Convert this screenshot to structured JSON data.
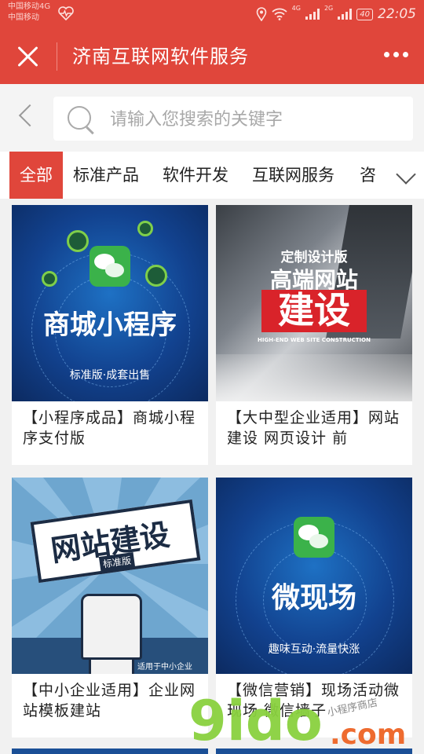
{
  "status_bar": {
    "carrier_line1": "中国移动4G",
    "carrier_line2": "中国移动",
    "net1": "4G",
    "net2": "2G",
    "battery": "40",
    "time": "22:05"
  },
  "title_bar": {
    "title": "济南互联网软件服务"
  },
  "search": {
    "placeholder": "请输入您搜索的关键字"
  },
  "tabs": [
    "全部",
    "标准产品",
    "软件开发",
    "互联网服务",
    "咨"
  ],
  "products": [
    {
      "title": "【小程序成品】商城小程序支付版",
      "art_title": "商城小程序",
      "art_sub": "标准版·成套出售"
    },
    {
      "title": "【大中型企业适用】网站建设 网页设计 前",
      "art_top": "定制设计版",
      "art_mid": "高端网站",
      "art_big": "建设",
      "art_sub": "HIGH-END WEB SITE CONSTRUCTION"
    },
    {
      "title": "【中小企业适用】企业网站模板建站",
      "art_title": "网站建设",
      "art_badge": "标准版",
      "art_sub": "适用于中小企业"
    },
    {
      "title": "【微信营销】现场活动微现场 微信墙子",
      "art_title": "微现场",
      "art_sub": "趣味互动·流量快涨"
    }
  ],
  "watermark": {
    "brand": "9ido",
    "suffix": ".com",
    "tag": "小程序商店"
  },
  "colors": {
    "brand_red": "#e0463b",
    "wechat_green": "#3bb24a"
  }
}
